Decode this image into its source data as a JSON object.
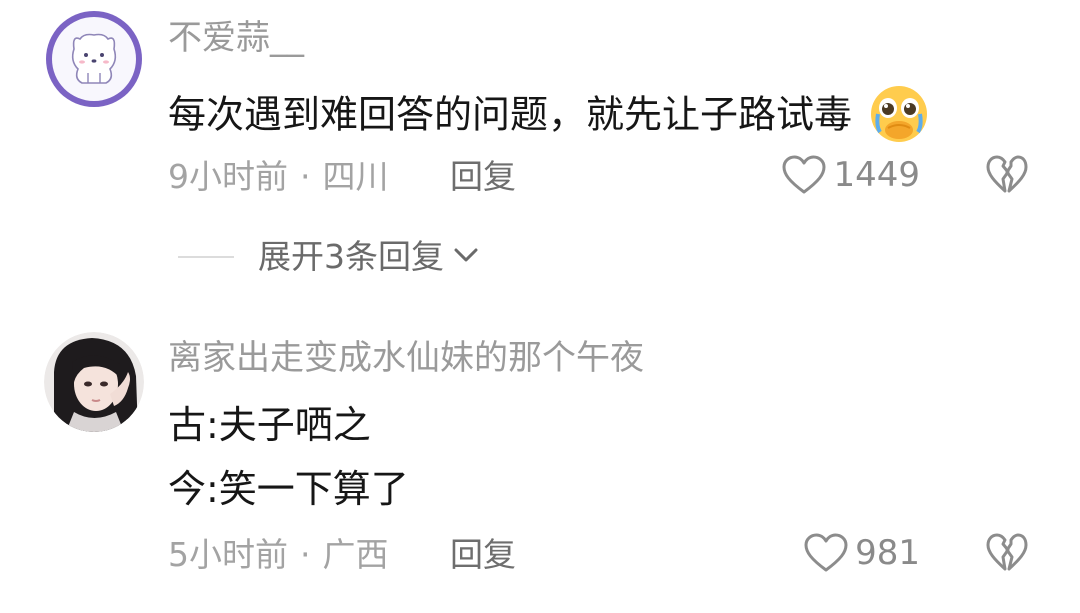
{
  "comments": [
    {
      "username": "不爱蒜__",
      "text": "每次遇到难回答的问题，就先让子路试毒",
      "emoji_icon": "pleading-face-crying-emoji-icon",
      "time": "9小时前",
      "separator": "·",
      "location": "四川",
      "reply_label": "回复",
      "like_count": "1449",
      "expand_label": "展开3条回复"
    },
    {
      "username": "离家出走变成水仙妹的那个午夜",
      "lines": [
        "古:夫子哂之",
        "今:笑一下算了"
      ],
      "time": "5小时前",
      "separator": "·",
      "location": "广西",
      "reply_label": "回复",
      "like_count": "981"
    }
  ],
  "colors": {
    "username": "#9a9a9a",
    "text": "#161616",
    "meta": "#a3a3a3",
    "avatar_ring": "#7b63c4"
  }
}
